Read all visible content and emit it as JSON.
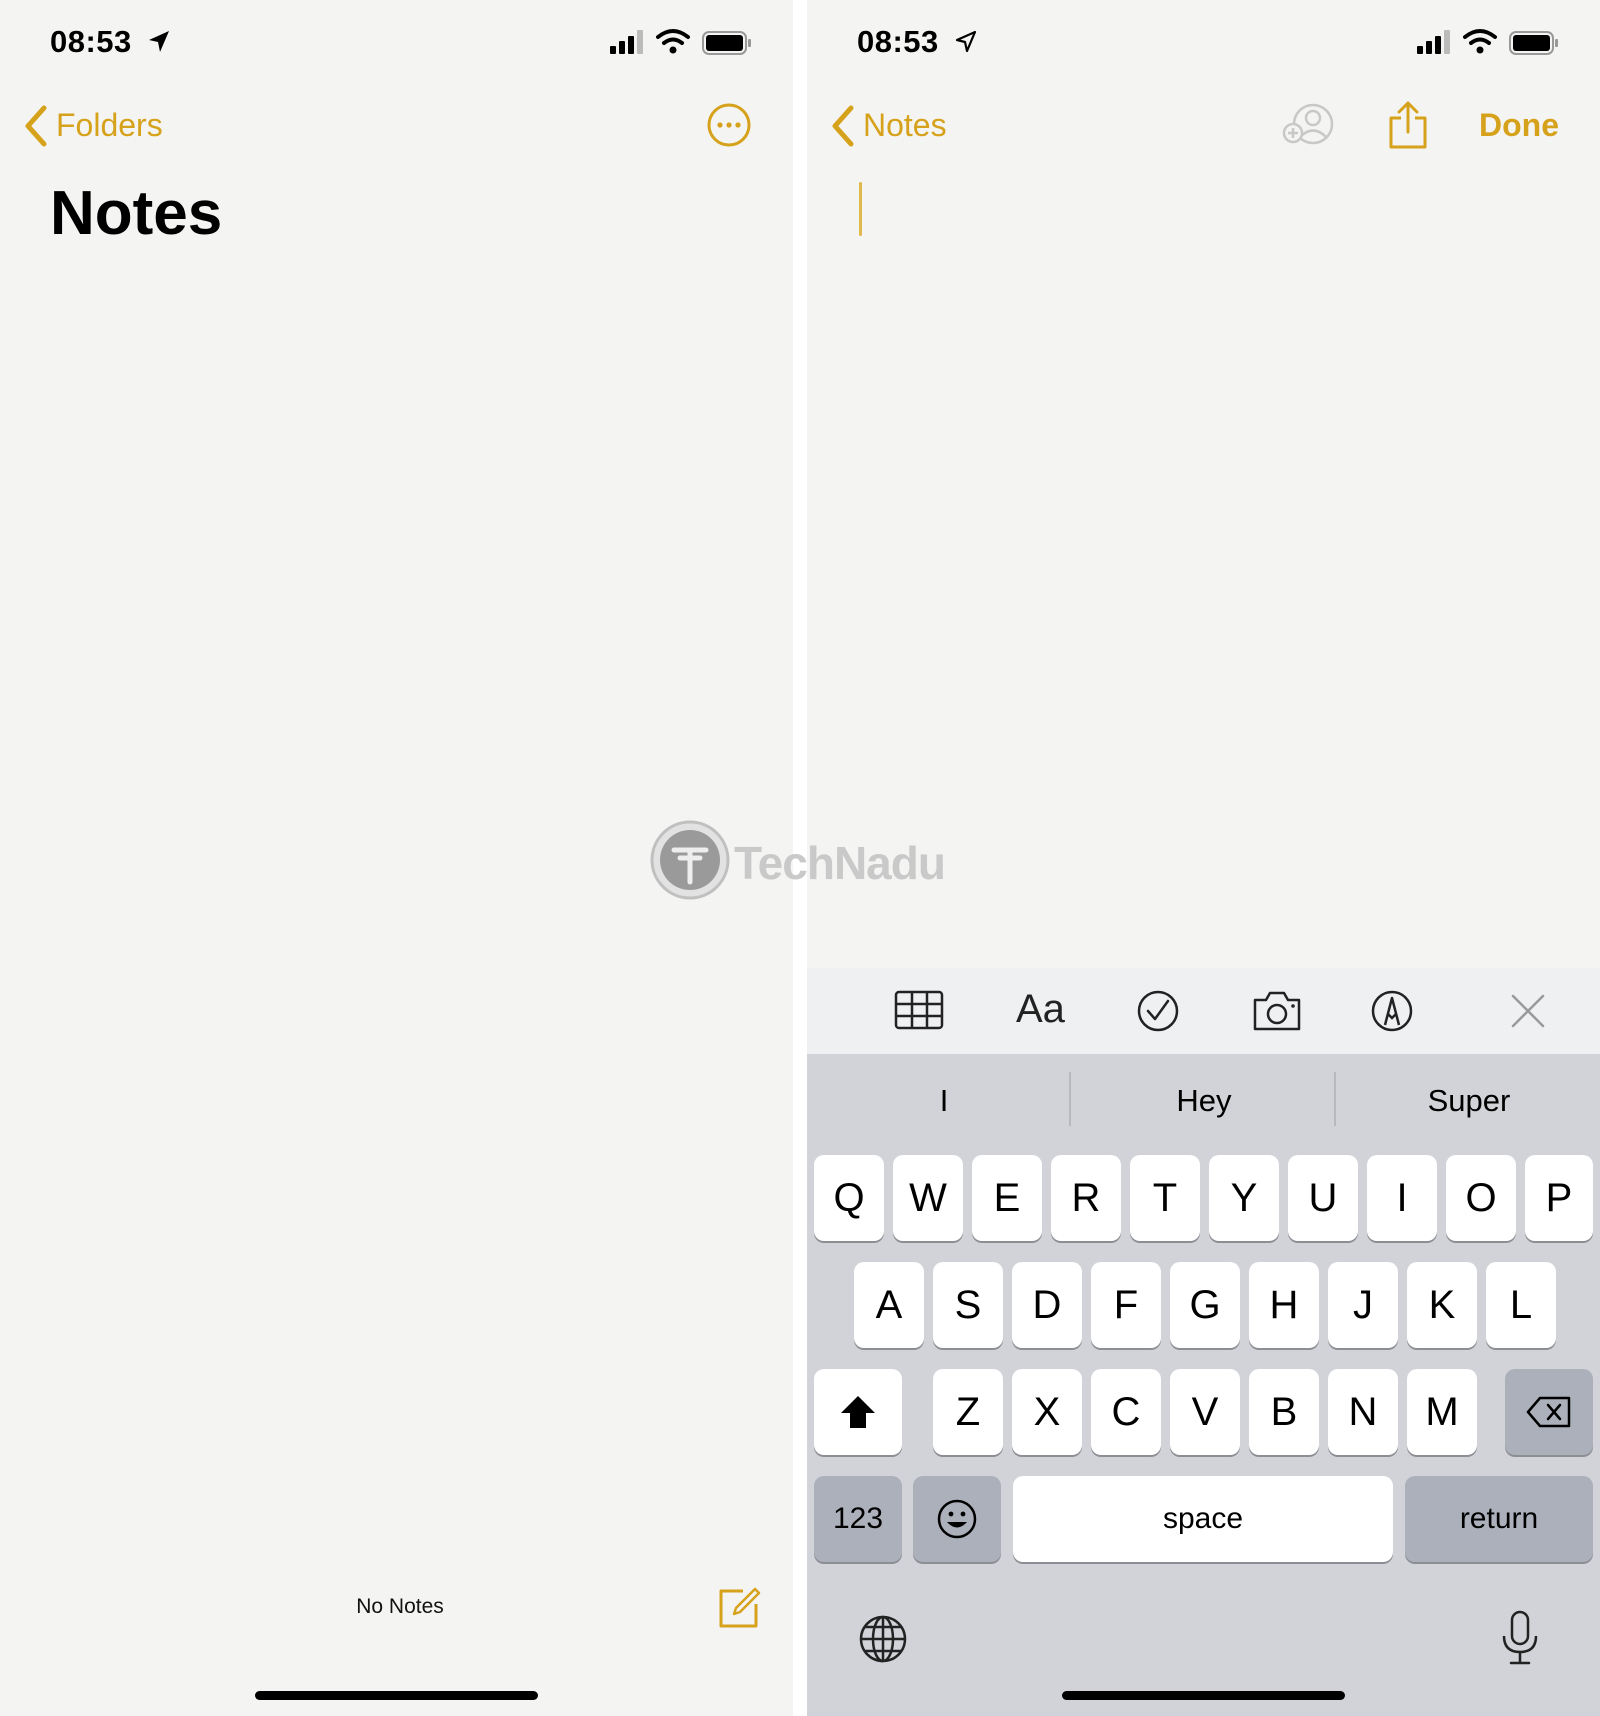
{
  "left_screen": {
    "status": {
      "time": "08:53"
    },
    "nav": {
      "back_label": "Folders"
    },
    "title": "Notes",
    "footer": {
      "count_label": "No Notes"
    }
  },
  "right_screen": {
    "status": {
      "time": "08:53"
    },
    "nav": {
      "back_label": "Notes",
      "done_label": "Done"
    },
    "toolbar": {
      "format_label": "Aa"
    },
    "predictions": [
      "I",
      "Hey",
      "Super"
    ],
    "keyboard": {
      "row1": [
        "Q",
        "W",
        "E",
        "R",
        "T",
        "Y",
        "U",
        "I",
        "O",
        "P"
      ],
      "row2": [
        "A",
        "S",
        "D",
        "F",
        "G",
        "H",
        "J",
        "K",
        "L"
      ],
      "row3": [
        "Z",
        "X",
        "C",
        "V",
        "B",
        "N",
        "M"
      ],
      "numbers_label": "123",
      "space_label": "space",
      "return_label": "return"
    }
  },
  "watermark": {
    "text": "TechNadu"
  },
  "colors": {
    "accent": "#d6a21c",
    "paper": "#f4f4f2",
    "keyboard_bg": "#d1d3d9",
    "key": "#ffffff",
    "key_dark": "#abb0ba"
  },
  "icons": [
    "location-arrow-icon",
    "signal-icon",
    "wifi-icon",
    "battery-icon",
    "chevron-left-icon",
    "more-icon",
    "compose-icon",
    "add-people-icon",
    "share-icon",
    "table-icon",
    "checklist-icon",
    "camera-icon",
    "markup-icon",
    "close-icon",
    "shift-icon",
    "delete-icon",
    "emoji-icon",
    "globe-icon",
    "microphone-icon"
  ]
}
